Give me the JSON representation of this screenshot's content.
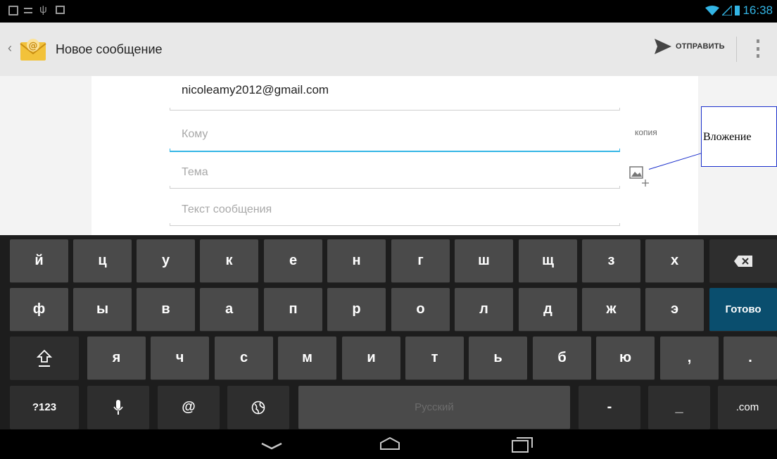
{
  "status_bar": {
    "time": "16:38"
  },
  "action_bar": {
    "title": "Новое сообщение",
    "send_label": "ОТПРАВИТЬ"
  },
  "compose": {
    "from": "nicoleamy2012@gmail.com",
    "to_placeholder": "Кому",
    "cc_label": "копия",
    "subject_placeholder": "Тема",
    "body_placeholder": "Текст сообщения"
  },
  "annotation": {
    "label": "Вложение"
  },
  "keyboard": {
    "row1": [
      "й",
      "ц",
      "у",
      "к",
      "е",
      "н",
      "г",
      "ш",
      "щ",
      "з",
      "х"
    ],
    "row2": [
      "ф",
      "ы",
      "в",
      "а",
      "п",
      "р",
      "о",
      "л",
      "д",
      "ж",
      "э"
    ],
    "done_label": "Готово",
    "row3": [
      "я",
      "ч",
      "с",
      "м",
      "и",
      "т",
      "ь",
      "б",
      "ю",
      ",",
      "."
    ],
    "symbols_label": "?123",
    "at_label": "@",
    "space_label": "Русский",
    "dash_label": "-",
    "underscore_label": "_",
    "dotcom_label": ".com"
  },
  "icons": [
    "back-icon",
    "email-app-icon",
    "send-icon",
    "overflow-menu-icon",
    "attach-icon",
    "backspace-icon",
    "shift-icon",
    "microphone-icon",
    "globe-icon",
    "nav-back-icon",
    "nav-home-icon",
    "nav-recents-icon"
  ],
  "colors": {
    "accent": "#33b5e5",
    "done_key": "#0a4e6e",
    "callout": "#1a2fcc"
  }
}
